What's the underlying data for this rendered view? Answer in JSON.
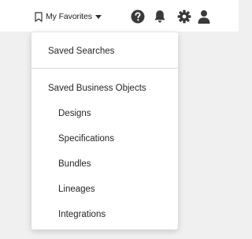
{
  "header": {
    "favorites_label": "My Favorites",
    "icons": [
      "bookmark-icon",
      "help-icon",
      "bell-icon",
      "gear-icon",
      "user-icon"
    ]
  },
  "menu": {
    "saved_searches": "Saved Searches",
    "section_title": "Saved Business Objects",
    "items": [
      {
        "label": "Designs"
      },
      {
        "label": "Specifications"
      },
      {
        "label": "Bundles"
      },
      {
        "label": "Lineages"
      },
      {
        "label": "Integrations"
      }
    ]
  },
  "colors": {
    "background": "#f0f0f0",
    "surface": "#ffffff",
    "icon": "#3a3a3a",
    "text": "#262626"
  }
}
